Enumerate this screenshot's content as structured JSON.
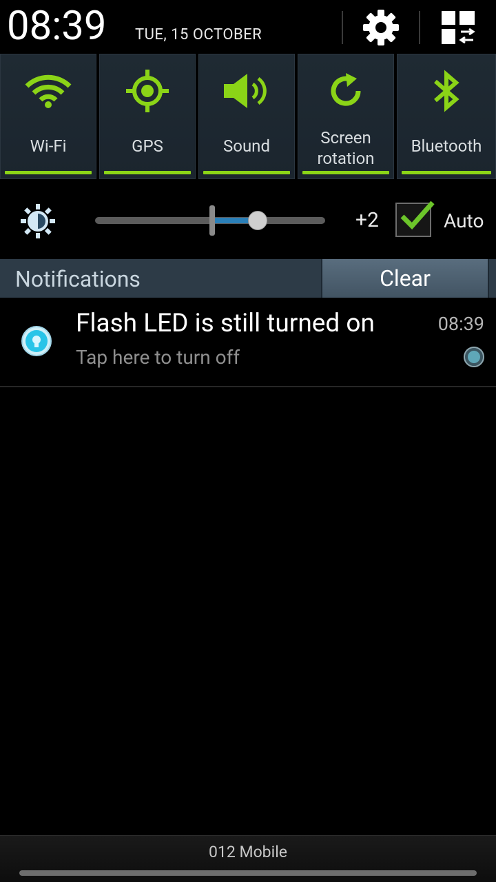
{
  "header": {
    "time": "08:39",
    "date": "TUE, 15 OCTOBER"
  },
  "quick_settings": [
    {
      "label": "Wi-Fi",
      "icon": "wifi-icon",
      "enabled": true
    },
    {
      "label": "GPS",
      "icon": "gps-icon",
      "enabled": true
    },
    {
      "label": "Sound",
      "icon": "sound-icon",
      "enabled": true
    },
    {
      "label": "Screen rotation",
      "line1": "Screen",
      "line2": "rotation",
      "icon": "screen-rotation-icon",
      "enabled": true
    },
    {
      "label": "Bluetooth",
      "icon": "bluetooth-icon",
      "enabled": true
    }
  ],
  "brightness": {
    "value": "+2",
    "auto_label": "Auto",
    "auto_checked": true
  },
  "notifications": {
    "title": "Notifications",
    "clear_label": "Clear",
    "items": [
      {
        "title": "Flash LED is still turned on",
        "subtitle": "Tap here to turn off",
        "time": "08:39",
        "icon": "flashlight-icon"
      }
    ]
  },
  "footer": {
    "carrier": "012 Mobile"
  },
  "colors": {
    "accent_green": "#8bd417",
    "panel_bg": "#1f2a33",
    "notif_header_bg": "#2d3b47",
    "slider_blue": "#2a7fb8"
  }
}
